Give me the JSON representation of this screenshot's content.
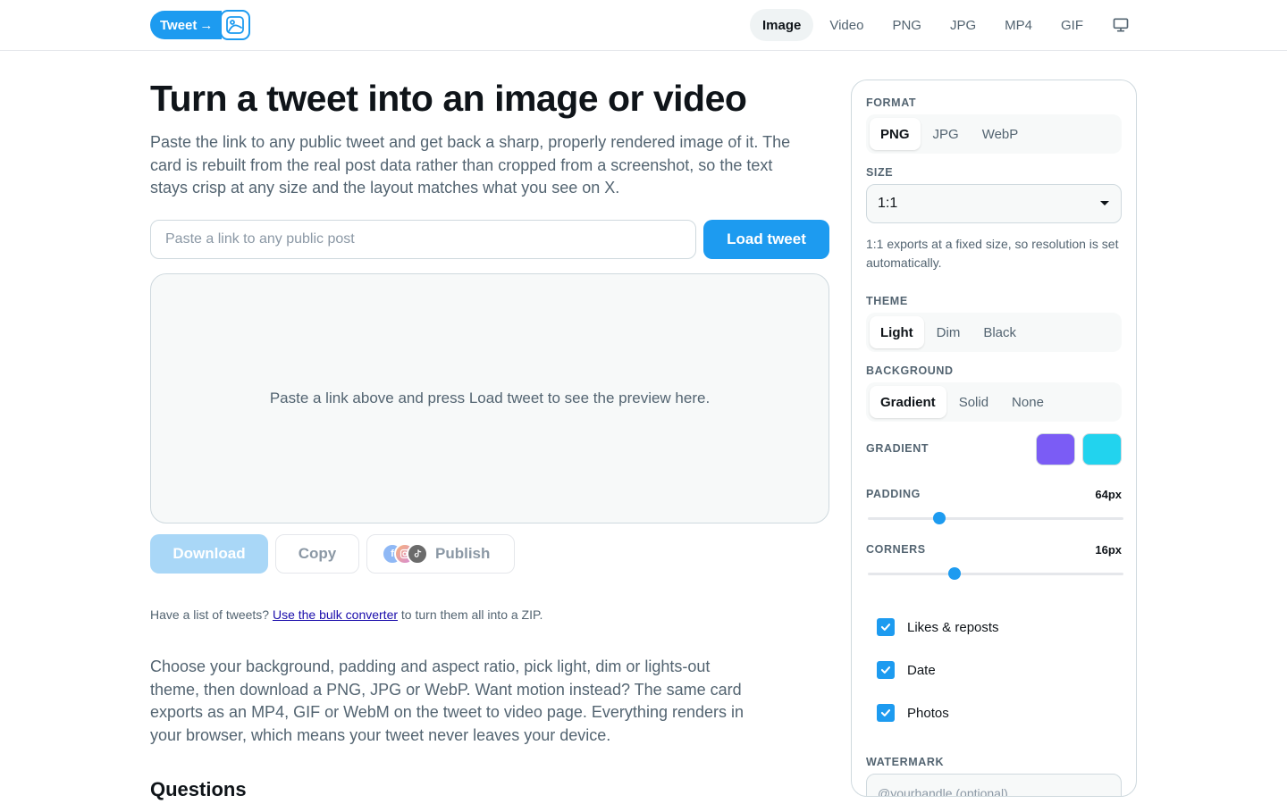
{
  "header": {
    "logo_text": "Tweet",
    "logo_arrow": "→",
    "logo_icon": "image-frame-icon",
    "nav": [
      "Image",
      "Video",
      "PNG",
      "JPG",
      "MP4",
      "GIF"
    ],
    "active_nav": "Image",
    "display_icon": "monitor-icon"
  },
  "main": {
    "title": "Turn a tweet into an image or video",
    "lead": "Paste the link to any public tweet and get back a sharp, properly rendered image of it. The card is rebuilt from the real post data rather than cropped from a screenshot, so the text stays crisp at any size and the layout matches what you see on X.",
    "input_placeholder": "Paste a link to any public post",
    "input_value": "",
    "load_button": "Load tweet",
    "preview_text": "Paste a link above and press Load tweet to see the preview here.",
    "download_button": "Download",
    "copy_button": "Copy",
    "publish_button": "Publish",
    "publish_icons": [
      "facebook-icon",
      "instagram-icon",
      "tiktok-icon"
    ],
    "bulk_prefix": "Have a list of tweets? ",
    "bulk_link": "Use the bulk converter",
    "bulk_suffix": " to turn them all into a ZIP.",
    "paragraph2": "Choose your background, padding and aspect ratio, pick light, dim or lights-out theme, then download a PNG, JPG or WebP. Want motion instead? The same card exports as an MP4, GIF or WebM on the tweet to video page. Everything renders in your browser, which means your tweet never leaves your device.",
    "questions_heading": "Questions"
  },
  "panel": {
    "format_label": "FORMAT",
    "format_options": [
      "PNG",
      "JPG",
      "WebP"
    ],
    "format_selected": "PNG",
    "size_label": "SIZE",
    "size_value": "1:1",
    "size_hint": "1:1 exports at a fixed size, so resolution is set automatically.",
    "theme_label": "THEME",
    "theme_options": [
      "Light",
      "Dim",
      "Black"
    ],
    "theme_selected": "Light",
    "background_label": "BACKGROUND",
    "background_options": [
      "Gradient",
      "Solid",
      "None"
    ],
    "background_selected": "Gradient",
    "gradient_label": "GRADIENT",
    "gradient_colors": [
      "#7b5cf5",
      "#22d3ee"
    ],
    "padding_label": "PADDING",
    "padding_value": "64px",
    "padding_fraction": 0.28,
    "corners_label": "CORNERS",
    "corners_value": "16px",
    "corners_fraction": 0.34,
    "checkboxes": [
      {
        "label": "Likes & reposts",
        "checked": true
      },
      {
        "label": "Date",
        "checked": true
      },
      {
        "label": "Photos",
        "checked": true
      }
    ],
    "watermark_label": "WATERMARK",
    "watermark_placeholder": "@yourhandle (optional)"
  },
  "colors": {
    "accent": "#1d9bf0",
    "accent_disabled": "#a9d7f7",
    "text": "#0f1419",
    "muted": "#536471",
    "border": "#cfd9de"
  }
}
